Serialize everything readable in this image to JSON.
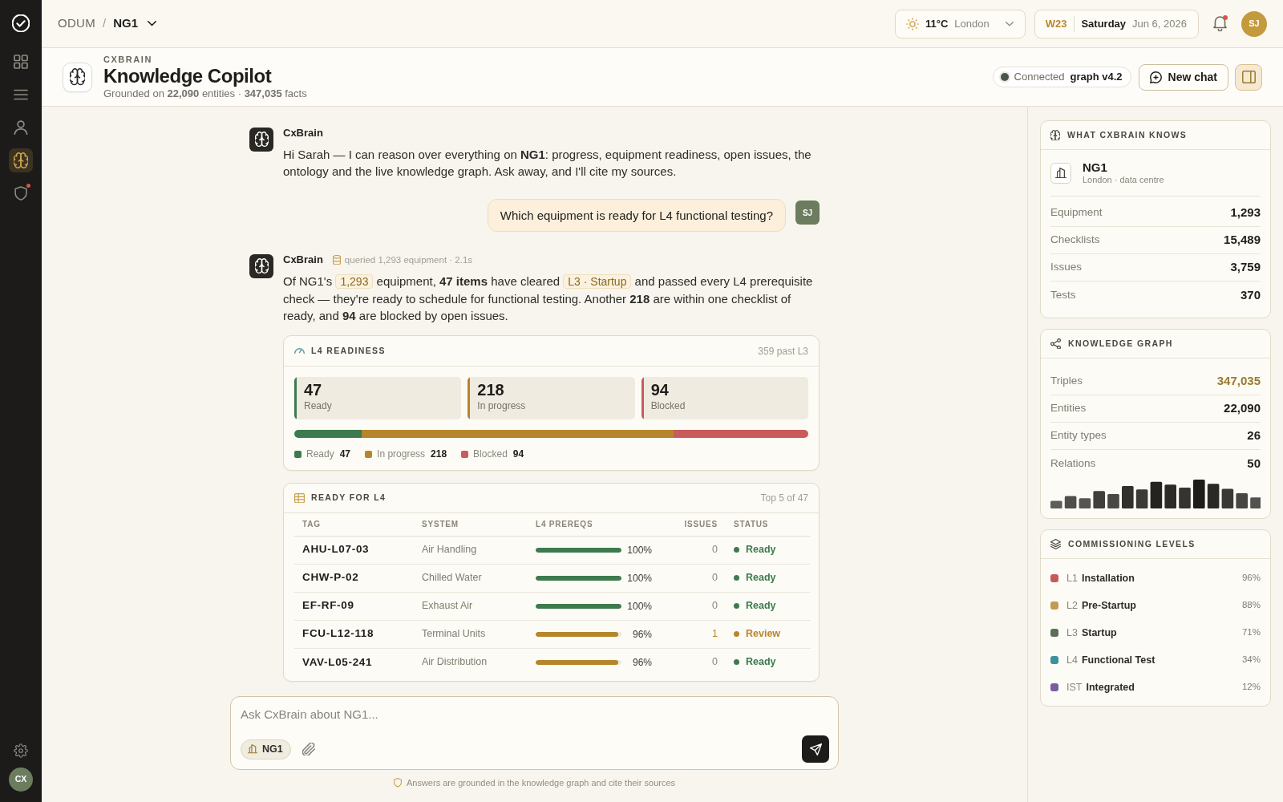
{
  "sidebar": {
    "items": [
      {
        "selected": false,
        "alert": false
      },
      {
        "selected": false,
        "alert": false
      },
      {
        "selected": false,
        "alert": false
      },
      {
        "selected": true,
        "alert": false
      },
      {
        "selected": false,
        "alert": true
      }
    ],
    "user": {
      "initials": "CX"
    }
  },
  "topbar": {
    "breadcrumb": {
      "items": [
        "ODUM",
        "NG1"
      ],
      "separator": "/"
    },
    "weather": {
      "temperature": "11°C",
      "city": "London"
    },
    "date": {
      "week": "W23",
      "weekday": "Saturday",
      "date": "Jun 6, 2026"
    },
    "notifications": {
      "unread": true
    },
    "user": {
      "initials": "SJ"
    }
  },
  "header": {
    "eyebrow": "CXBRAIN",
    "title": "Knowledge Copilot",
    "subtitle": "Grounded on **22,090** entities · **347,035** facts",
    "status": {
      "connected": true,
      "label": "Connected",
      "version": "graph v4.2"
    },
    "new_chat": "New chat",
    "panel_toggle": {
      "on": true
    }
  },
  "chat": {
    "messages": [
      {
        "kind": "assistant",
        "author": "CxBrain",
        "body": [
          {
            "kind": "text",
            "text": "Hi Sarah — I can reason over everything on **NG1**: progress, equipment readiness, open issues, the ontology and the live knowledge graph. Ask away, and I'll cite my sources."
          }
        ]
      },
      {
        "kind": "user",
        "initials": "SJ",
        "body": [
          {
            "kind": "text",
            "text": "Which equipment is ready for L4 functional testing?"
          }
        ]
      },
      {
        "kind": "assistant",
        "author": "CxBrain",
        "meta": "queried 1,293 equipment · 2.1s",
        "body": [
          {
            "kind": "text",
            "text": "Of NG1's "
          },
          {
            "kind": "chip",
            "text": "1,293"
          },
          {
            "kind": "text",
            "text": " equipment, **47 items** have cleared "
          },
          {
            "kind": "chip",
            "text": "L3 · Startup"
          },
          {
            "kind": "text",
            "text": " and passed every L4 prerequisite check — they're ready to schedule for functional testing. Another **218** are within one checklist of ready, and **94** are blocked by open issues."
          }
        ],
        "readiness": {
          "title": "L4 READINESS",
          "note": "359 past L3",
          "tiles": [
            {
              "value": "47",
              "label": "Ready",
              "color": "#3d7a4e"
            },
            {
              "value": "218",
              "label": "In progress",
              "color": "#b5862b"
            },
            {
              "value": "94",
              "label": "Blocked",
              "color": "#c95b5b"
            }
          ],
          "legend": [
            {
              "label": "Ready",
              "value": "47",
              "color": "#3d7a4e"
            },
            {
              "label": "In progress",
              "value": "218",
              "color": "#b5862b"
            },
            {
              "label": "Blocked",
              "value": "94",
              "color": "#c95b5b"
            }
          ]
        },
        "table": {
          "title": "READY FOR L4",
          "note": "Top 5 of 47",
          "columns": [
            "TAG",
            "SYSTEM",
            "L4 PREREQS",
            "ISSUES",
            "STATUS"
          ],
          "rows": [
            {
              "kind": "ready",
              "tag": "AHU-L07-03",
              "system": "Air Handling",
              "level": 1.0,
              "percent": "100%",
              "issues": "0",
              "status": "Ready"
            },
            {
              "kind": "ready",
              "tag": "CHW-P-02",
              "system": "Chilled Water",
              "level": 1.0,
              "percent": "100%",
              "issues": "0",
              "status": "Ready"
            },
            {
              "kind": "ready",
              "tag": "EF-RF-09",
              "system": "Exhaust Air",
              "level": 1.0,
              "percent": "100%",
              "issues": "0",
              "status": "Ready"
            },
            {
              "kind": "review",
              "tag": "FCU-L12-118",
              "system": "Terminal Units",
              "level": 0.96,
              "percent": "96%",
              "issues": "1",
              "status": "Review"
            },
            {
              "kind": "ready",
              "tag": "VAV-L05-241",
              "system": "Air Distribution",
              "level": 0.96,
              "percent": "96%",
              "issues": "0",
              "status": "Ready"
            }
          ]
        }
      }
    ]
  },
  "composer": {
    "placeholder": "Ask CxBrain about NG1...",
    "scope": "NG1",
    "footnote": "Answers are grounded in the knowledge graph and cite their sources"
  },
  "panel": {
    "knows": {
      "title": "WHAT CXBRAIN KNOWS",
      "site": {
        "name": "NG1",
        "subtitle": "London · data centre"
      },
      "stats": [
        {
          "label": "Equipment",
          "value": "1,293"
        },
        {
          "label": "Checklists",
          "value": "15,489"
        },
        {
          "label": "Issues",
          "value": "3,759"
        },
        {
          "label": "Tests",
          "value": "370"
        }
      ]
    },
    "graph": {
      "title": "KNOWLEDGE GRAPH",
      "stats": [
        {
          "label": "Triples",
          "value": "347,035",
          "highlight": true
        },
        {
          "label": "Entities",
          "value": "22,090",
          "highlight": false
        },
        {
          "label": "Entity types",
          "value": "26",
          "highlight": false
        },
        {
          "label": "Relations",
          "value": "50",
          "highlight": false
        }
      ]
    },
    "levels": {
      "title": "COMMISSIONING LEVELS",
      "items": [
        {
          "code": "L1",
          "name": "Installation",
          "percent": "96%",
          "color": "#c65a55"
        },
        {
          "code": "L2",
          "name": "Pre-Startup",
          "percent": "88%",
          "color": "#c49a52"
        },
        {
          "code": "L3",
          "name": "Startup",
          "percent": "71%",
          "color": "#5f6e57"
        },
        {
          "code": "L4",
          "name": "Functional Test",
          "percent": "34%",
          "color": "#3e909c"
        },
        {
          "code": "IST",
          "name": "Integrated",
          "percent": "12%",
          "color": "#7b5aa6"
        }
      ]
    }
  }
}
